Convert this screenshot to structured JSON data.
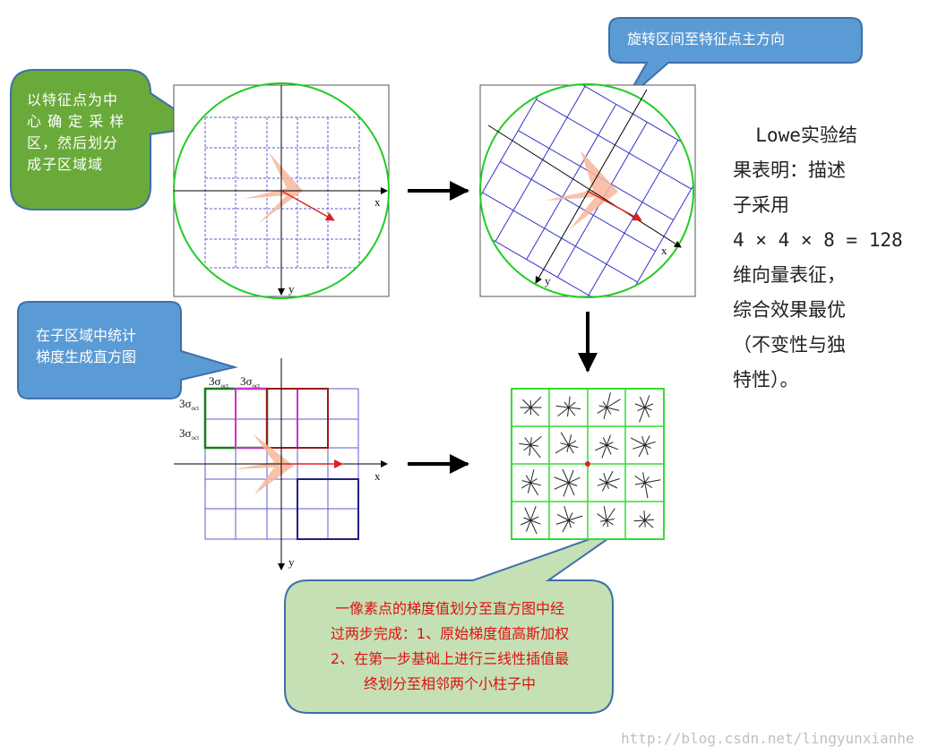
{
  "callouts": {
    "sample_region": {
      "lines": [
        "以特征点为中",
        "心 确 定 采 样",
        "区，然后划分",
        "成子区域域"
      ],
      "color": "#6aaa3a"
    },
    "rotate": {
      "lines": [
        "旋转区间至特征点主方向"
      ],
      "color": "#5b9bd5"
    },
    "histogram": {
      "lines": [
        "在子区域中统计",
        "梯度生成直方图"
      ],
      "color": "#5b9bd5"
    },
    "pixel_assign": {
      "lines": [
        "一像素点的梯度值划分至直方图中经",
        "过两步完成：1、原始梯度值高斯加权",
        "2、在第一步基础上进行三线性插值最",
        "终划分至相邻两个小柱子中"
      ],
      "color": "#c5e0b4",
      "text_color": "#e01010"
    }
  },
  "summary": {
    "lines": [
      "  Lowe实验结",
      "果表明：描述",
      "子采用",
      "4 × 4 × 8 = 128",
      "维向量表征，",
      "综合效果最优",
      "（不变性与独",
      "特性）。"
    ]
  },
  "axes": {
    "x_label": "x",
    "y_label": "y"
  },
  "sigma_labels": {
    "base": "3σ",
    "subscript": "oct"
  },
  "watermark": "http://blog.csdn.net/lingyunxianhe",
  "colors": {
    "circle": "#22cc22",
    "grid_blue": "#3333cc",
    "arrow_red": "#e02020",
    "cone": "#f6b79a",
    "desc_green": "#33dd33"
  }
}
